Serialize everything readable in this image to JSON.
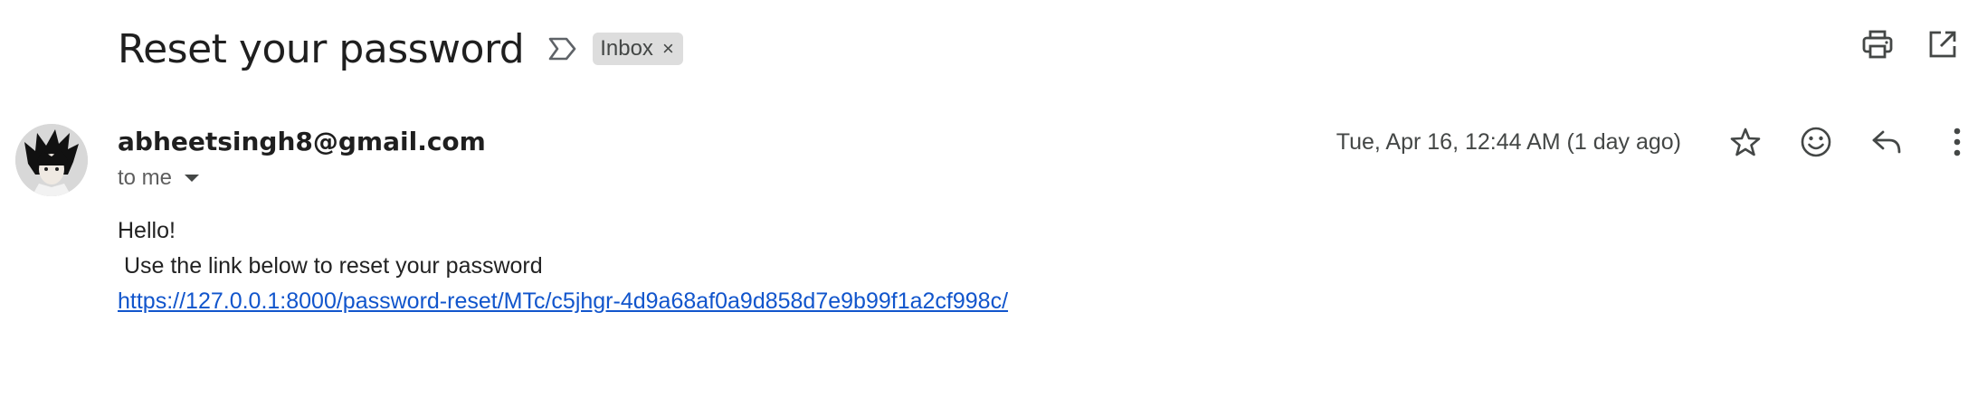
{
  "email": {
    "subject": "Reset your password",
    "labels": [
      {
        "name": "Inbox",
        "remove_symbol": "×"
      }
    ],
    "sender": "abheetsingh8@gmail.com",
    "recipients_text": "to me",
    "date": "Tue, Apr 16, 12:44 AM (1 day ago)",
    "body": {
      "greeting": "Hello!",
      "line": " Use the link below to reset your password",
      "link": "https://127.0.0.1:8000/password-reset/MTc/c5jhgr-4d9a68af0a9d858d7e9b99f1a2cf998c/"
    }
  },
  "icons": {
    "importance": "importance-marker-icon",
    "print": "print-icon",
    "open_new_window": "open-in-new-window-icon",
    "star": "star-icon",
    "emoji": "emoji-reaction-icon",
    "reply": "reply-icon",
    "more": "more-vertical-icon"
  },
  "colors": {
    "link": "#1155cc",
    "chip_bg": "#dddddd",
    "text_primary": "#1f1f1f",
    "text_secondary": "#444746"
  }
}
